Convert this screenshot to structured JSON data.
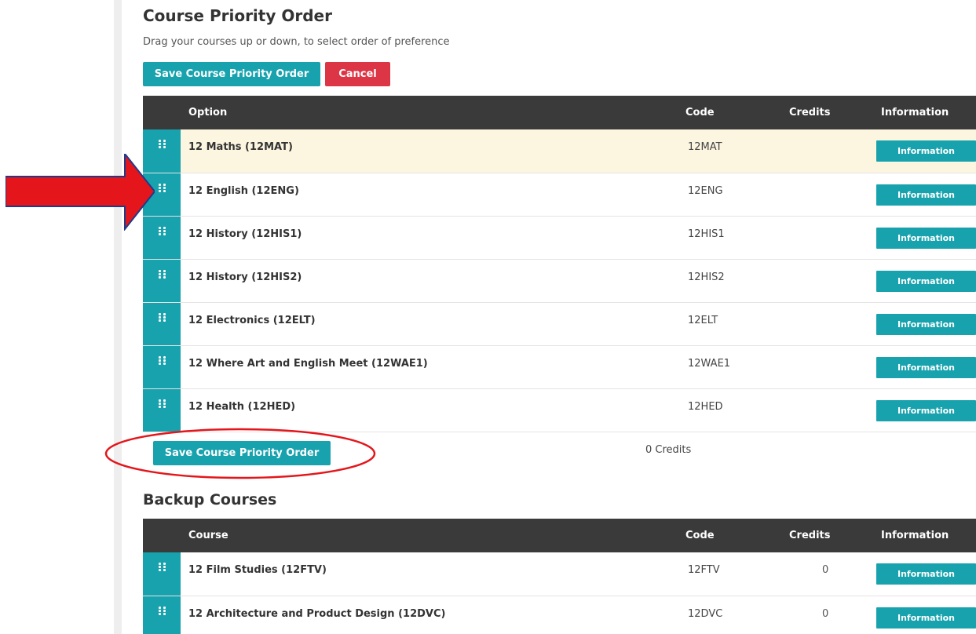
{
  "page": {
    "title": "Course Priority Order",
    "subtitle": "Drag your courses up or down, to select order of preference"
  },
  "toolbar": {
    "save_label": "Save Course Priority Order",
    "cancel_label": "Cancel"
  },
  "priority_table": {
    "headers": {
      "option": "Option",
      "code": "Code",
      "credits": "Credits",
      "information": "Information"
    },
    "rows": [
      {
        "name": "12 Maths (12MAT)",
        "code": "12MAT",
        "credits": "",
        "info": "Information"
      },
      {
        "name": "12 English (12ENG)",
        "code": "12ENG",
        "credits": "",
        "info": "Information"
      },
      {
        "name": "12 History (12HIS1)",
        "code": "12HIS1",
        "credits": "",
        "info": "Information"
      },
      {
        "name": "12 History (12HIS2)",
        "code": "12HIS2",
        "credits": "",
        "info": "Information"
      },
      {
        "name": "12 Electronics (12ELT)",
        "code": "12ELT",
        "credits": "",
        "info": "Information"
      },
      {
        "name": "12 Where Art and English Meet (12WAE1)",
        "code": "12WAE1",
        "credits": "",
        "info": "Information"
      },
      {
        "name": "12 Health (12HED)",
        "code": "12HED",
        "credits": "",
        "info": "Information"
      }
    ],
    "footer_save_label": "Save Course Priority Order",
    "total_credits": "0 Credits"
  },
  "backup": {
    "title": "Backup Courses",
    "headers": {
      "course": "Course",
      "code": "Code",
      "credits": "Credits",
      "information": "Information"
    },
    "rows": [
      {
        "name": "12 Film Studies (12FTV)",
        "code": "12FTV",
        "credits": "0",
        "info": "Information"
      },
      {
        "name": "12 Architecture and Product Design (12DVC)",
        "code": "12DVC",
        "credits": "0",
        "info": "Information"
      }
    ]
  },
  "colors": {
    "accent": "#17a2ad",
    "danger": "#dc3545",
    "header_bg": "#3a3a3a",
    "highlight_row": "#fcf5df",
    "annotation": "#e4161b"
  },
  "icons": {
    "drag_handle": "drag-handle-icon",
    "annotation_arrow": "red-arrow-annotation",
    "annotation_ellipse": "red-ellipse-annotation"
  }
}
